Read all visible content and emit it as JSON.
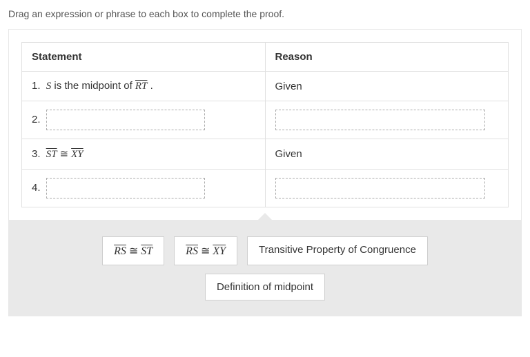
{
  "instruction": "Drag an expression or phrase to each box to complete the proof.",
  "headers": {
    "statement": "Statement",
    "reason": "Reason"
  },
  "rows": {
    "r1": {
      "num": "1.",
      "s_pre": "S",
      "s_mid": " is the midpoint of ",
      "seg": "RT",
      "s_post": " .",
      "reason": "Given"
    },
    "r2": {
      "num": "2."
    },
    "r3": {
      "num": "3.",
      "seg1": "ST",
      "cong": "≅",
      "seg2": "XY",
      "reason": "Given"
    },
    "r4": {
      "num": "4."
    }
  },
  "tiles": {
    "t1": {
      "seg1": "RS",
      "cong": "≅",
      "seg2": "ST"
    },
    "t2": {
      "seg1": "RS",
      "cong": "≅",
      "seg2": "XY"
    },
    "t3": {
      "label": "Transitive Property of Congruence"
    },
    "t4": {
      "label": "Definition of midpoint"
    }
  }
}
